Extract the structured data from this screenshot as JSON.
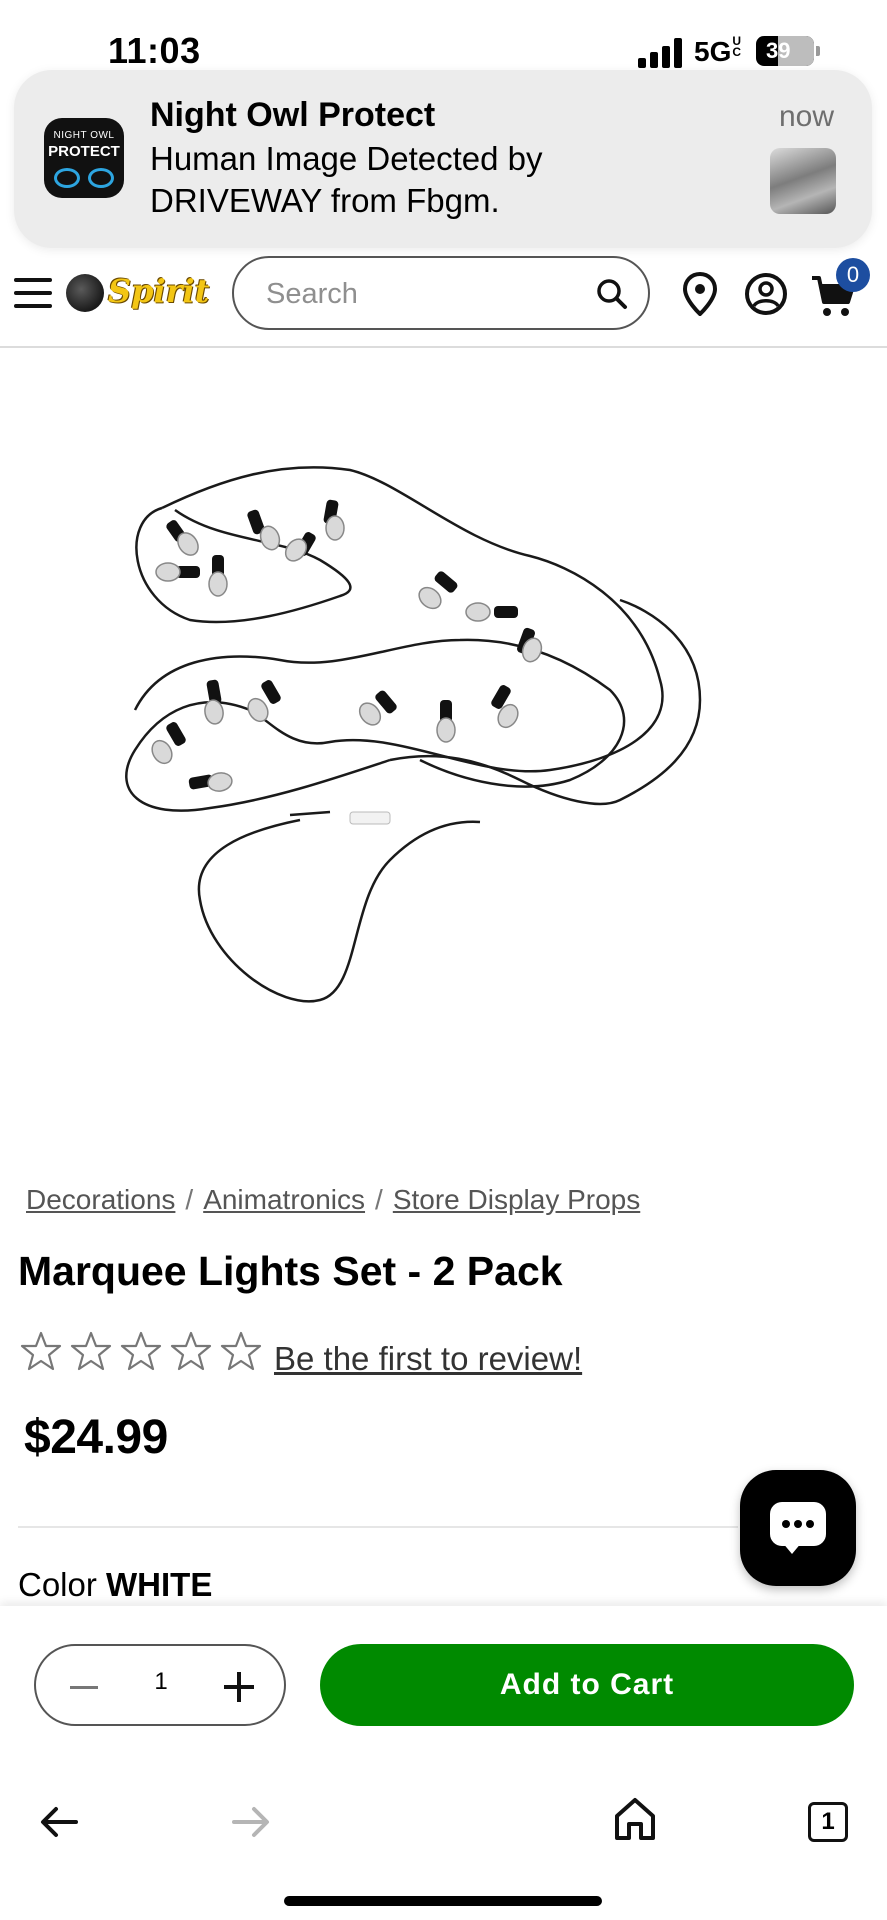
{
  "status_bar": {
    "time": "11:03",
    "network": "5G",
    "network_sup": "UC",
    "battery": "39"
  },
  "notification": {
    "icon_text_top": "NIGHT OWL",
    "icon_text_bottom": "PROTECT",
    "title": "Night Owl Protect",
    "time": "now",
    "body": "Human Image Detected by DRIVEWAY  from Fbgm."
  },
  "header": {
    "logo_text": "Spirit",
    "search_placeholder": "Search",
    "cart_count": "0"
  },
  "breadcrumb": {
    "items": [
      "Decorations",
      "Animatronics",
      "Store Display Props"
    ],
    "separator": "/"
  },
  "product": {
    "title": "Marquee Lights Set - 2 Pack",
    "rating": 0,
    "rating_max": 5,
    "review_link": "Be the first to review!",
    "price": "$24.99",
    "color_label": "Color",
    "color_value": "WHITE"
  },
  "purchase_bar": {
    "quantity": "1",
    "add_to_cart": "Add to Cart",
    "accent_color": "#008a00"
  },
  "browser_bar": {
    "tab_count": "1"
  }
}
